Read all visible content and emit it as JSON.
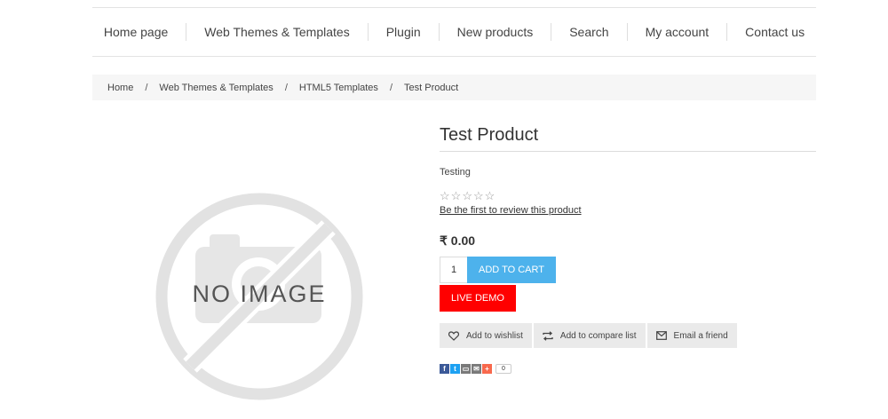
{
  "nav": {
    "items": [
      "Home page",
      "Web Themes & Templates",
      "Plugin",
      "New products",
      "Search",
      "My account",
      "Contact us"
    ]
  },
  "breadcrumb": {
    "items": [
      "Home",
      "Web Themes & Templates",
      "HTML5 Templates"
    ],
    "current": "Test Product",
    "separator": "/"
  },
  "image": {
    "text": "NO IMAGE",
    "icon": "no-image-placeholder"
  },
  "product": {
    "title": "Test Product",
    "description": "Testing",
    "rating": {
      "stars": 5,
      "filled": 0,
      "icon": "star-outline-icon"
    },
    "review_link": "Be the first to review this product",
    "price": "₹ 0.00",
    "quantity": "1",
    "add_to_cart": "ADD TO CART",
    "live_demo": "LIVE DEMO",
    "actions": {
      "wishlist": "Add to wishlist",
      "compare": "Add to compare list",
      "email": "Email a friend"
    },
    "share": {
      "icons": [
        "facebook-icon",
        "twitter-icon",
        "print-icon",
        "email-icon",
        "plus-icon"
      ],
      "count": "0"
    }
  },
  "colors": {
    "add_to_cart": "#4db2ec",
    "live_demo": "#ff0000",
    "action_bg": "#eaeaea",
    "breadcrumb_bg": "#f6f6f6"
  }
}
